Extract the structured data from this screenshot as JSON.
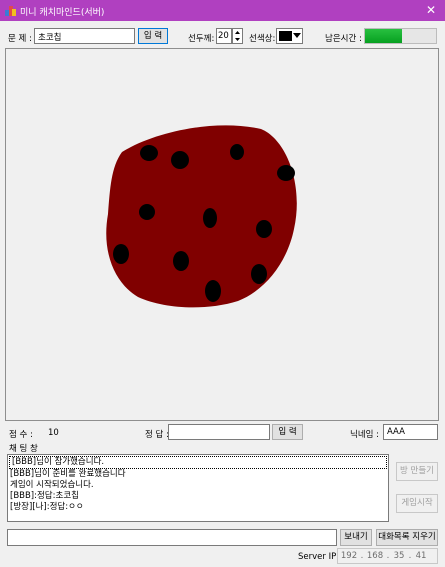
{
  "window": {
    "title": "미니 캐치마인드(서버)",
    "close_glyph": "✕"
  },
  "toolbar": {
    "problem_label": "문 제 :",
    "problem_value": "초코칩",
    "problem_submit": "입 력",
    "thickness_label": "선두께:",
    "thickness_value": "20",
    "color_label": "선색상:",
    "color_value": "#000000",
    "time_label": "남은시간 :",
    "time_remaining_fraction": 0.52
  },
  "drawing": {
    "blob_color": "#800000",
    "dot_color": "#000000"
  },
  "status": {
    "score_label": "점 수 :",
    "score_value": "10",
    "answer_label": "정 답 :",
    "answer_value": "",
    "answer_submit": "입 력",
    "nickname_label": "닉네임 :",
    "nickname_value": "AAA"
  },
  "chat": {
    "label": "채 팅 창",
    "messages": [
      "[BBB]님이 참가했습니다.",
      "[BBB]님이 준비를 완료했습니다",
      "게임이 시작되었습니다.",
      "[BBB]:정답:초코칩",
      "[방장][나]:정답:ㅇㅇ"
    ],
    "input_value": "",
    "send_button": "보내기",
    "clear_button": "대화목록 지우기"
  },
  "side_buttons": {
    "make_room": "방 만들기",
    "start_game": "게임시작"
  },
  "server": {
    "label": "Server IP",
    "ip": [
      "192",
      "168",
      "35",
      "41"
    ]
  }
}
